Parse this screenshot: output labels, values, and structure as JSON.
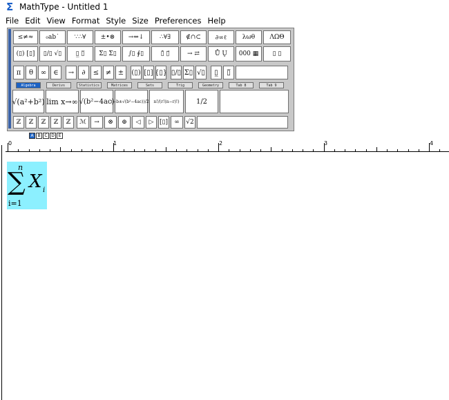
{
  "window": {
    "title": "MathType - Untitled 1"
  },
  "menu": [
    "File",
    "Edit",
    "View",
    "Format",
    "Style",
    "Size",
    "Preferences",
    "Help"
  ],
  "palette_row1": [
    "≤≠≈",
    "₀ab˙",
    "∵∴∀",
    "±•⊗",
    "→⇔↓",
    "∴∀∃",
    "∉∩⊂",
    "∂∞ℓ",
    "λωθ",
    "ΛΩΘ"
  ],
  "palette_row2": [
    "(▯) [▯]",
    "▯/▯ √▯",
    "▯̲ ▯̅",
    "Σ▯ Σ▯",
    "∫▯ ∮▯",
    "▯̄ ▯⃗",
    "→ ⇄",
    "Ů Ų",
    "000 ▦",
    "▯ ▯"
  ],
  "palette_row3": [
    "π",
    "θ",
    "∞",
    "∈",
    "→",
    "∂",
    "≤",
    "≠",
    "±",
    "(▯)",
    "[▯]",
    "{▯}",
    "▯/▯",
    "Σ▯",
    "√▯",
    "▯̲",
    "▯̅"
  ],
  "tabs": [
    "Algebra",
    "Derivs",
    "Statistics",
    "Matrices",
    "Sets",
    "Trig",
    "Geometry",
    "Tab 8",
    "Tab 9"
  ],
  "active_tab": "Algebra",
  "templates": [
    "√(a²+b²)",
    "lim x→∞",
    "√(b²−4ac)",
    "(−b±√(b²−4ac))/2a",
    "n!/(r!(n−r)!)",
    "1/2"
  ],
  "palette_row5": [
    "ℤ",
    "ℤ",
    "ℤ",
    "ℤ",
    "ℤ",
    "ℳ",
    "→",
    "⊗",
    "⊕",
    "◁",
    "▷",
    "[▯]",
    "∞",
    "√2"
  ],
  "status_icons": [
    "A",
    "B",
    "C",
    "D",
    "E"
  ],
  "ruler_labels": [
    "0",
    "1",
    "2",
    "3",
    "4"
  ],
  "equation": {
    "operator": "∑",
    "upper": "n",
    "lower": "i=1",
    "variable": "X",
    "index": "i"
  },
  "colors": {
    "equation_highlight": "#8cf0ff",
    "active_tab": "#1c62c4",
    "toolbar_bg": "#c8c8c8"
  }
}
